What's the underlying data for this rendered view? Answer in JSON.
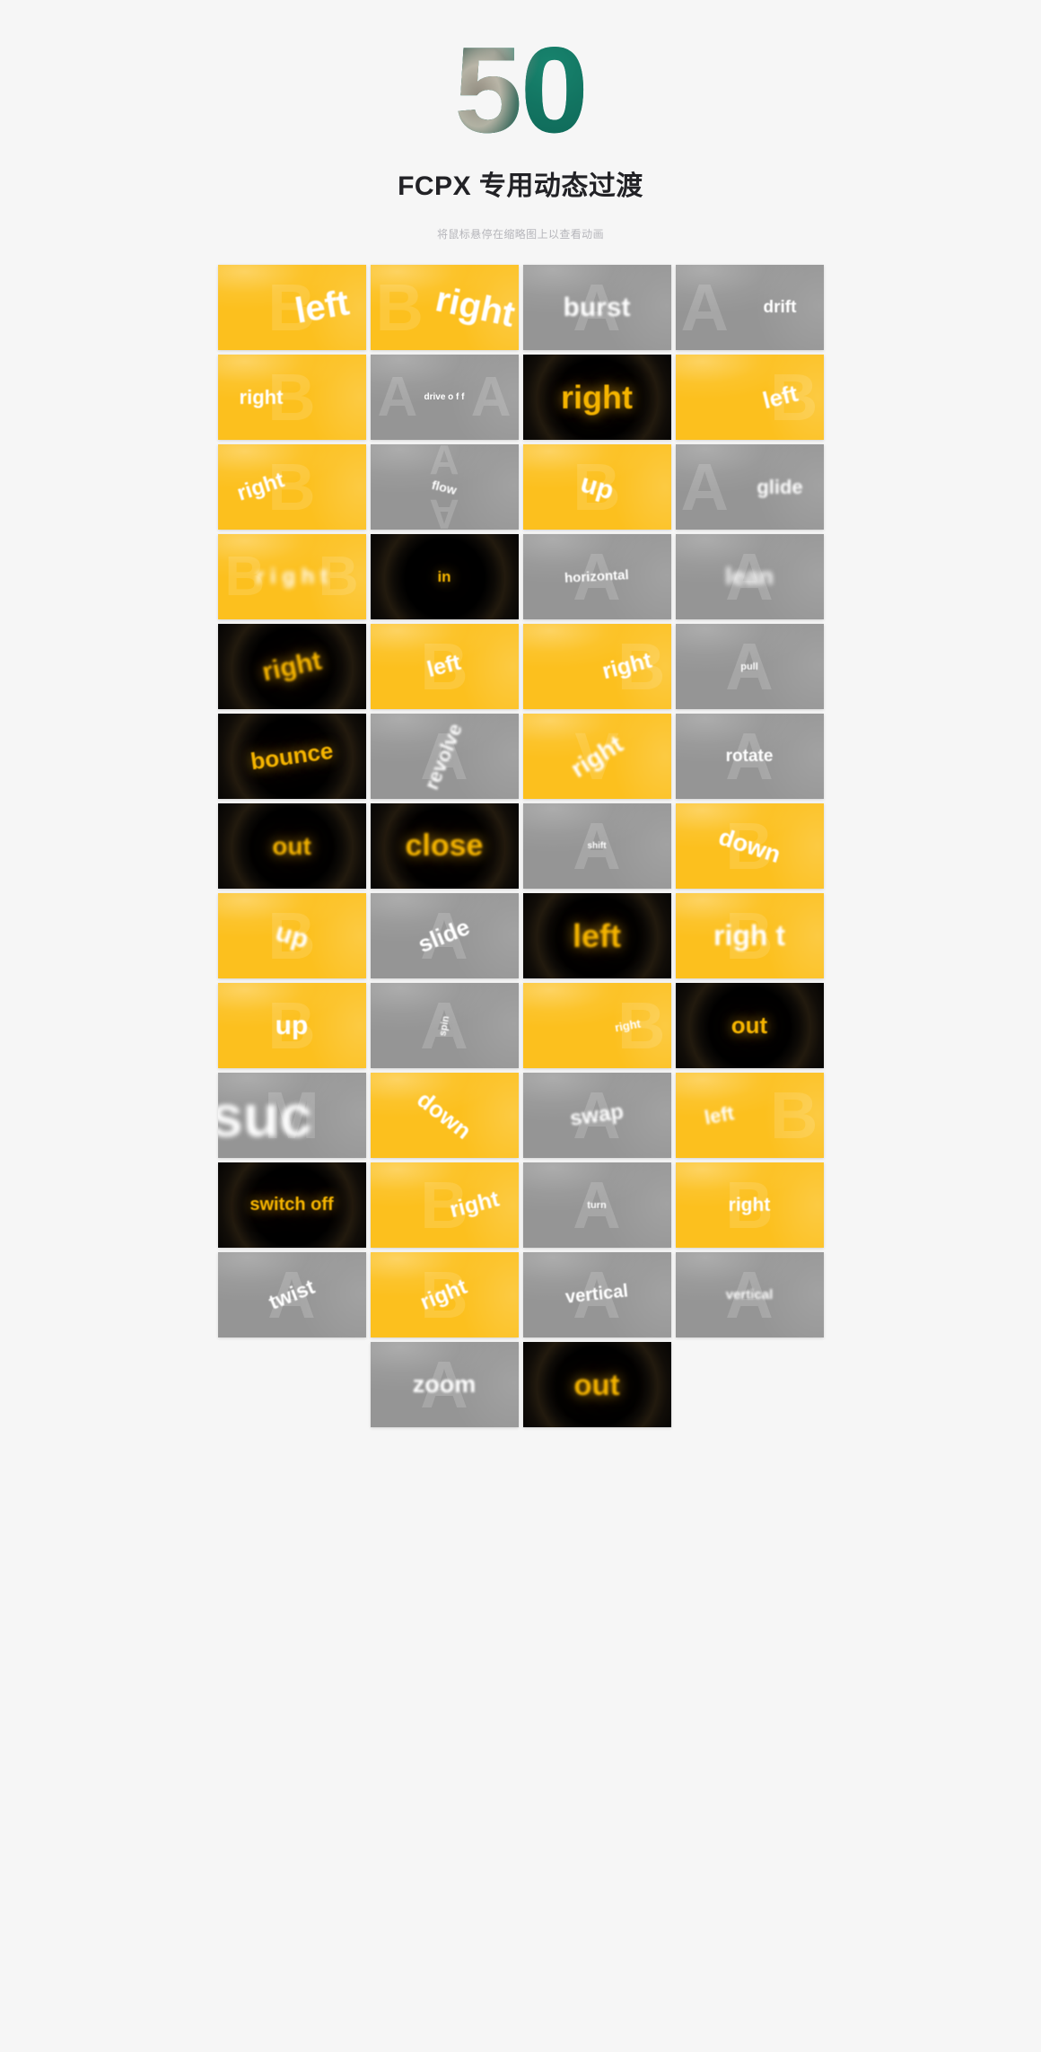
{
  "header": {
    "big_number": "50",
    "title": "FCPX 专用动态过渡",
    "hint": "将鼠标悬停在缩略图上以查看动画",
    "number_color": "#12806a",
    "accent_yellow": "#fcc01e",
    "accent_gray": "#959595",
    "accent_black": "#000000",
    "page_background": "#f6f6f6"
  },
  "grid": {
    "columns": 4,
    "rows": 13,
    "thumbnails": [
      {
        "label": "left",
        "style": "yellow",
        "ghost": "B",
        "size": 40,
        "rotate": -10,
        "blur": 1,
        "pos": "right",
        "ghost_pos": "center"
      },
      {
        "label": "right",
        "style": "yellow",
        "ghost": "B",
        "size": 40,
        "rotate": 12,
        "blur": 1,
        "pos": "right",
        "ghost_pos": "left"
      },
      {
        "label": "burst",
        "style": "gray",
        "ghost": "A",
        "size": 30,
        "rotate": 0,
        "blur": 2,
        "pos": "center",
        "ghost_pos": "center"
      },
      {
        "label": "drift",
        "style": "gray",
        "ghost": "A",
        "size": 19,
        "rotate": 0,
        "blur": 1,
        "pos": "right",
        "ghost_pos": "left"
      },
      {
        "label": "right",
        "style": "yellow",
        "ghost": "B",
        "size": 22,
        "rotate": 0,
        "blur": 1,
        "pos": "left",
        "ghost_pos": "center"
      },
      {
        "label": "drive o f f",
        "style": "gray",
        "ghost": "A",
        "size": 10,
        "rotate": 0,
        "blur": 0,
        "pos": "center",
        "ghost_pos": "wide"
      },
      {
        "label": "right",
        "style": "black",
        "ghost": "",
        "size": 36,
        "rotate": 0,
        "blur": 1,
        "pos": "center",
        "ghost_pos": "center"
      },
      {
        "label": "left",
        "style": "yellow",
        "ghost": "B",
        "size": 26,
        "rotate": -14,
        "blur": 1,
        "pos": "right",
        "ghost_pos": "right"
      },
      {
        "label": "right",
        "style": "yellow",
        "ghost": "B",
        "size": 24,
        "rotate": -18,
        "blur": 1,
        "pos": "left",
        "ghost_pos": "center"
      },
      {
        "label": "flow",
        "style": "gray",
        "ghost": "A",
        "size": 14,
        "rotate": 14,
        "blur": 1,
        "pos": "center",
        "ghost_pos": "vert"
      },
      {
        "label": "up",
        "style": "yellow",
        "ghost": "B",
        "size": 30,
        "rotate": 16,
        "blur": 1,
        "pos": "center",
        "ghost_pos": "center"
      },
      {
        "label": "glide",
        "style": "gray",
        "ghost": "A",
        "size": 22,
        "rotate": 0,
        "blur": 2,
        "pos": "right",
        "ghost_pos": "left"
      },
      {
        "label": "r i g h t",
        "style": "yellow",
        "ghost": "B",
        "size": 24,
        "rotate": 0,
        "blur": 3,
        "pos": "center",
        "ghost_pos": "wide"
      },
      {
        "label": "in",
        "style": "black",
        "ghost": "",
        "size": 17,
        "rotate": 0,
        "blur": 1,
        "pos": "center",
        "ghost_pos": "center"
      },
      {
        "label": "horizontal",
        "style": "gray",
        "ghost": "A",
        "size": 15,
        "rotate": -3,
        "blur": 1,
        "pos": "center",
        "ghost_pos": "center"
      },
      {
        "label": "lean",
        "style": "gray",
        "ghost": "A",
        "size": 27,
        "rotate": 0,
        "blur": 3,
        "pos": "center",
        "ghost_pos": "center"
      },
      {
        "label": "right",
        "style": "black",
        "ghost": "",
        "size": 30,
        "rotate": -12,
        "blur": 2,
        "pos": "center",
        "ghost_pos": "center"
      },
      {
        "label": "left",
        "style": "yellow",
        "ghost": "B",
        "size": 25,
        "rotate": -14,
        "blur": 1,
        "pos": "center",
        "ghost_pos": "center"
      },
      {
        "label": "right",
        "style": "yellow",
        "ghost": "B",
        "size": 25,
        "rotate": -14,
        "blur": 1,
        "pos": "right",
        "ghost_pos": "right"
      },
      {
        "label": "pull",
        "style": "gray",
        "ghost": "A",
        "size": 11,
        "rotate": 0,
        "blur": 1,
        "pos": "center",
        "ghost_pos": "center"
      },
      {
        "label": "bounce",
        "style": "black",
        "ghost": "",
        "size": 26,
        "rotate": -8,
        "blur": 1,
        "pos": "center",
        "ghost_pos": "center"
      },
      {
        "label": "revolve",
        "style": "gray",
        "ghost": "A",
        "size": 22,
        "rotate": -68,
        "blur": 2,
        "pos": "center",
        "ghost_pos": "center"
      },
      {
        "label": "right",
        "style": "yellow",
        "ghost": "V",
        "size": 28,
        "rotate": -32,
        "blur": 2,
        "pos": "center",
        "ghost_pos": "center"
      },
      {
        "label": "rotate",
        "style": "gray",
        "ghost": "A",
        "size": 19,
        "rotate": 0,
        "blur": 1,
        "pos": "center",
        "ghost_pos": "center"
      },
      {
        "label": "out",
        "style": "black",
        "ghost": "",
        "size": 28,
        "rotate": 0,
        "blur": 2,
        "pos": "center",
        "ghost_pos": "center"
      },
      {
        "label": "close",
        "style": "black",
        "ghost": "",
        "size": 34,
        "rotate": 0,
        "blur": 2,
        "pos": "center",
        "ghost_pos": "center"
      },
      {
        "label": "shift",
        "style": "gray",
        "ghost": "A",
        "size": 10,
        "rotate": 0,
        "blur": 1,
        "pos": "center",
        "ghost_pos": "center"
      },
      {
        "label": "down",
        "style": "yellow",
        "ghost": "B",
        "size": 27,
        "rotate": 18,
        "blur": 1,
        "pos": "center",
        "ghost_pos": "center"
      },
      {
        "label": "up",
        "style": "yellow",
        "ghost": "B",
        "size": 30,
        "rotate": 16,
        "blur": 2,
        "pos": "center",
        "ghost_pos": "center"
      },
      {
        "label": "slide",
        "style": "gray",
        "ghost": "A",
        "size": 26,
        "rotate": -22,
        "blur": 1,
        "pos": "center",
        "ghost_pos": "center"
      },
      {
        "label": "left",
        "style": "black",
        "ghost": "",
        "size": 36,
        "rotate": 0,
        "blur": 2,
        "pos": "center",
        "ghost_pos": "center"
      },
      {
        "label": "righ t",
        "style": "yellow",
        "ghost": "B",
        "size": 32,
        "rotate": 0,
        "blur": 2,
        "pos": "center",
        "ghost_pos": "center"
      },
      {
        "label": "up",
        "style": "yellow",
        "ghost": "B",
        "size": 30,
        "rotate": 0,
        "blur": 1,
        "pos": "center",
        "ghost_pos": "center"
      },
      {
        "label": "spin",
        "style": "gray",
        "ghost": "A",
        "size": 11,
        "rotate": -80,
        "blur": 1,
        "pos": "center",
        "ghost_pos": "center"
      },
      {
        "label": "right",
        "style": "yellow",
        "ghost": "B",
        "size": 13,
        "rotate": -10,
        "blur": 1,
        "pos": "right",
        "ghost_pos": "right"
      },
      {
        "label": "out",
        "style": "black",
        "ghost": "",
        "size": 26,
        "rotate": 0,
        "blur": 1,
        "pos": "center",
        "ghost_pos": "center"
      },
      {
        "label": "suc",
        "style": "gray",
        "ghost": "M",
        "size": 66,
        "rotate": 0,
        "blur": 3,
        "pos": "left",
        "ghost_pos": "center"
      },
      {
        "label": "down",
        "style": "yellow",
        "ghost": "",
        "size": 26,
        "rotate": 38,
        "blur": 1,
        "pos": "center",
        "ghost_pos": "center"
      },
      {
        "label": "swap",
        "style": "gray",
        "ghost": "A",
        "size": 24,
        "rotate": -8,
        "blur": 2,
        "pos": "center",
        "ghost_pos": "center"
      },
      {
        "label": "left",
        "style": "yellow",
        "ghost": "B",
        "size": 22,
        "rotate": -10,
        "blur": 2,
        "pos": "left",
        "ghost_pos": "right"
      },
      {
        "label": "switch off",
        "style": "black",
        "ghost": "",
        "size": 20,
        "rotate": 0,
        "blur": 1,
        "pos": "center",
        "ghost_pos": "center"
      },
      {
        "label": "right",
        "style": "yellow",
        "ghost": "B",
        "size": 25,
        "rotate": -14,
        "blur": 1,
        "pos": "right",
        "ghost_pos": "center"
      },
      {
        "label": "turn",
        "style": "gray",
        "ghost": "A",
        "size": 11,
        "rotate": 0,
        "blur": 1,
        "pos": "center",
        "ghost_pos": "center"
      },
      {
        "label": "right",
        "style": "yellow",
        "ghost": "B",
        "size": 21,
        "rotate": 0,
        "blur": 1,
        "pos": "center",
        "ghost_pos": "center"
      },
      {
        "label": "twist",
        "style": "gray",
        "ghost": "A",
        "size": 23,
        "rotate": -22,
        "blur": 1,
        "pos": "center",
        "ghost_pos": "center"
      },
      {
        "label": "right",
        "style": "yellow",
        "ghost": "B",
        "size": 24,
        "rotate": -22,
        "blur": 1,
        "pos": "center",
        "ghost_pos": "center"
      },
      {
        "label": "vertical",
        "style": "gray",
        "ghost": "A",
        "size": 20,
        "rotate": -6,
        "blur": 1,
        "pos": "center",
        "ghost_pos": "center"
      },
      {
        "label": "vertical",
        "style": "gray",
        "ghost": "A",
        "size": 15,
        "rotate": 0,
        "blur": 2,
        "pos": "center",
        "ghost_pos": "center"
      },
      {
        "label": "zoom",
        "style": "gray",
        "ghost": "A",
        "size": 27,
        "rotate": 0,
        "blur": 2,
        "pos": "center",
        "ghost_pos": "center",
        "column": 2
      },
      {
        "label": "out",
        "style": "black",
        "ghost": "",
        "size": 33,
        "rotate": 0,
        "blur": 2,
        "pos": "center",
        "ghost_pos": "center",
        "column": 3
      }
    ]
  }
}
